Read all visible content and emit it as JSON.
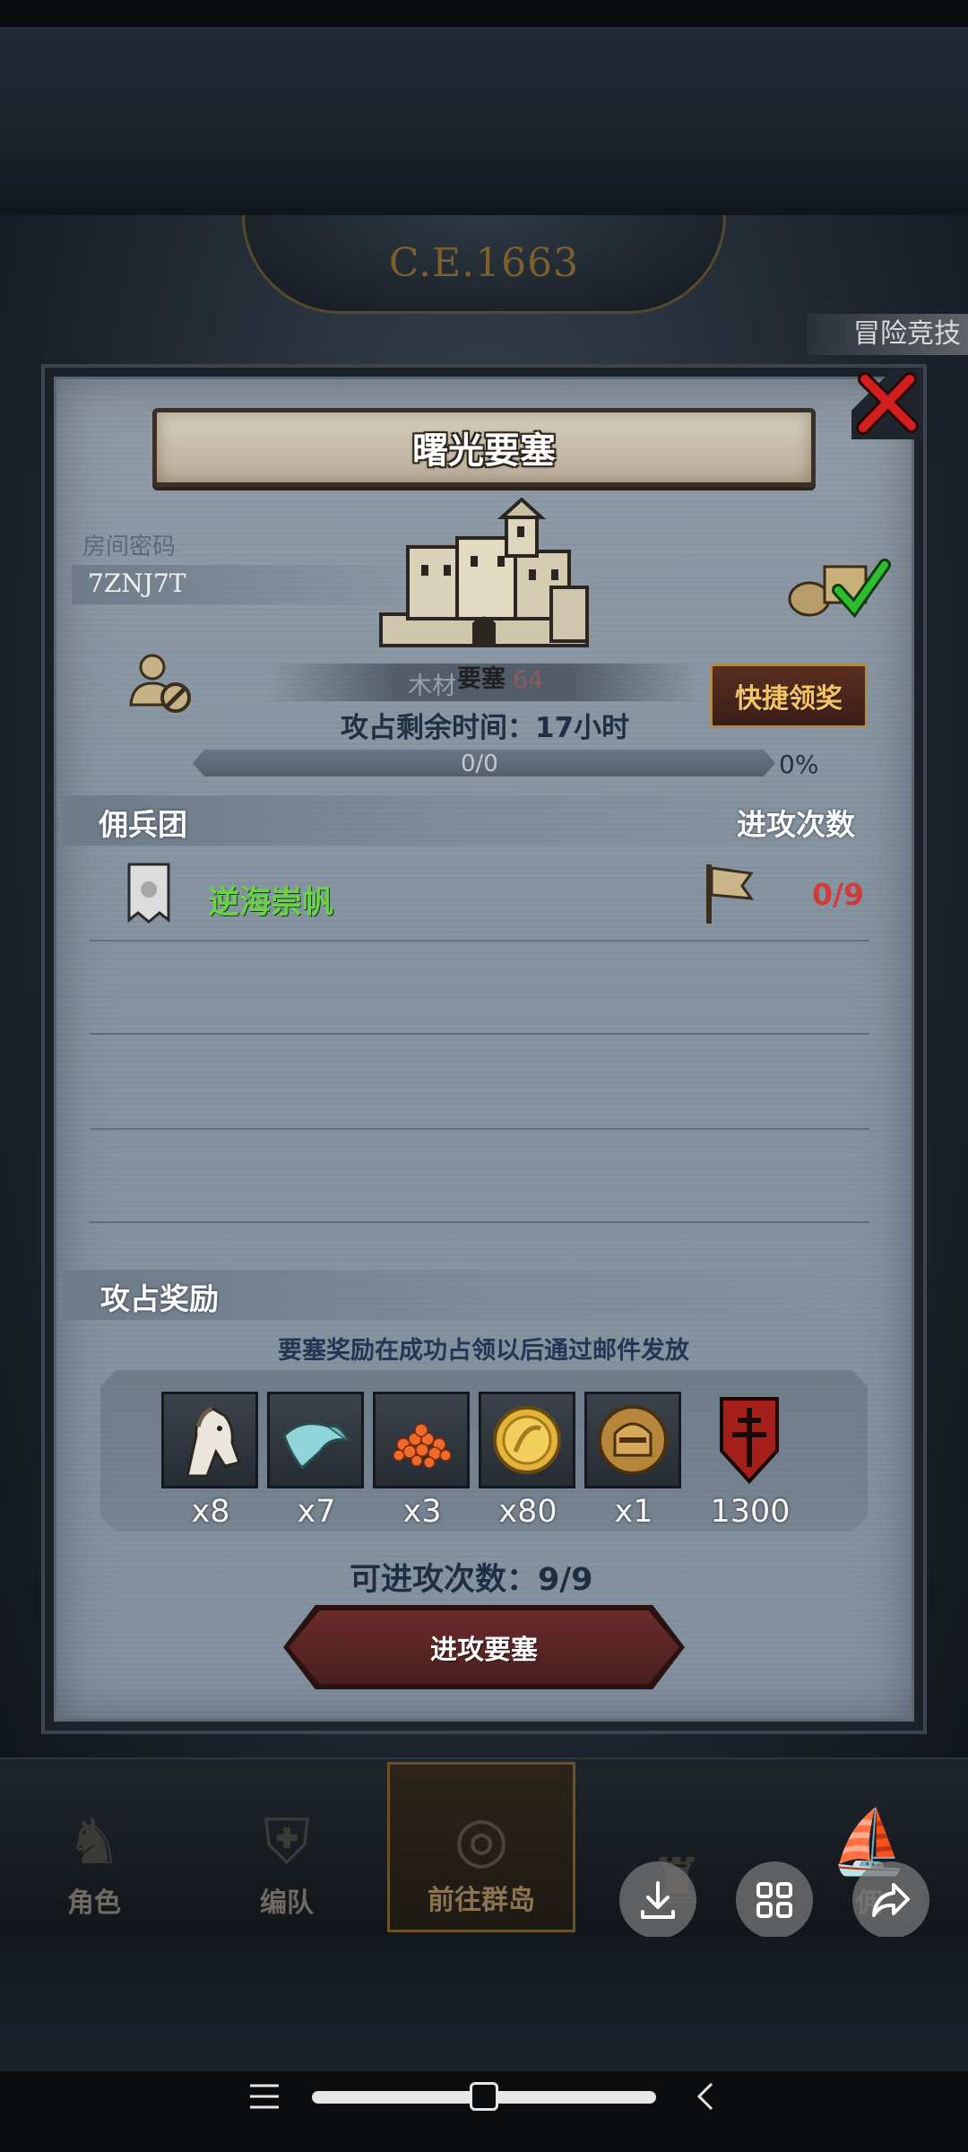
{
  "era": "C.E.1663",
  "side_badge": "冒险竞技",
  "dialog": {
    "title": "曙光要塞",
    "room_label": "房间密码",
    "room_code": "7ZNJ7T",
    "fortress_label": "要塞",
    "resource_name": "木材",
    "resource_value": "64",
    "claim_button": "快捷领奖",
    "remaining_time_label": "攻占剩余时间：17小时",
    "progress_text": "0/0",
    "progress_percent": "0%",
    "progress_value": 0
  },
  "mercenary": {
    "header": "佣兵团",
    "attack_count_header": "进攻次数",
    "rows": [
      {
        "name": "逆海崇帆",
        "count": "0/9"
      }
    ]
  },
  "rewards": {
    "header": "攻占奖励",
    "note": "要塞奖励在成功占领以后通过邮件发放",
    "items": [
      {
        "icon": "horse-icon",
        "qty": "x8"
      },
      {
        "icon": "cloth-icon",
        "qty": "x7"
      },
      {
        "icon": "caviar-icon",
        "qty": "x3"
      },
      {
        "icon": "gold-coin-icon",
        "qty": "x80"
      },
      {
        "icon": "knight-medal-icon",
        "qty": "x1"
      },
      {
        "icon": "red-crest-icon",
        "qty": "1300"
      }
    ]
  },
  "attempts_label": "可进攻次数：9/9",
  "attack_button": "进攻要塞",
  "bottom_nav": [
    {
      "label": "角色"
    },
    {
      "label": "编队"
    },
    {
      "label": "前往群岛"
    },
    {
      "label": ""
    },
    {
      "label": "佣"
    }
  ],
  "colors": {
    "guild_name": "#69d24a",
    "guild_count": "#d23b3b",
    "claim_text": "#f3c465"
  }
}
